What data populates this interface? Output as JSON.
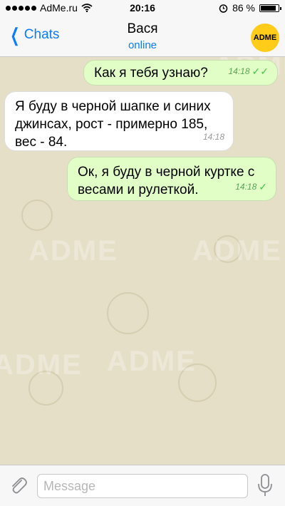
{
  "status_bar": {
    "carrier": "AdMe.ru",
    "time": "20:16",
    "battery": "86 %",
    "battery_level": 0.86
  },
  "header": {
    "back_label": "Chats",
    "contact_name": "Вася",
    "contact_status": "online",
    "avatar_text": "ADME"
  },
  "messages": [
    {
      "direction": "out",
      "text": "Как я тебя узнаю?",
      "time": "14:18",
      "status": "read"
    },
    {
      "direction": "in",
      "text": "Я буду в черной шапке и синих джинсах, рост - примерно 185, вес - 84.",
      "time": "14:18"
    },
    {
      "direction": "out",
      "text": "Ок, я буду в черной куртке с весами и рулеткой.",
      "time": "14:18",
      "status": "delivered"
    }
  ],
  "input": {
    "placeholder": "Message"
  },
  "watermark": "ADME",
  "colors": {
    "accent": "#0a7cff",
    "outgoing": "#e1fec6",
    "incoming": "#ffffff",
    "avatar": "#ffcc1a"
  }
}
